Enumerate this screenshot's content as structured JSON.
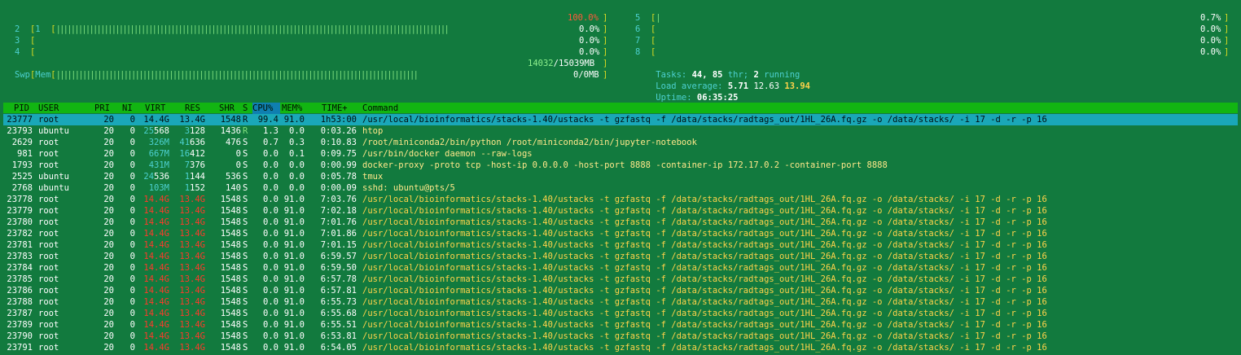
{
  "cpus_left": [
    {
      "id": "1",
      "bar": "||||||||||||||||||||||||||||||||||||||||||||||||||||||||||||||||||||||||||||||||||||||||||||||||||||||||||",
      "pct": "100.0%"
    },
    {
      "id": "2",
      "bar": "",
      "pct": "0.0%"
    },
    {
      "id": "3",
      "bar": "",
      "pct": "0.0%"
    },
    {
      "id": "4",
      "bar": "",
      "pct": "0.0%"
    }
  ],
  "cpus_right": [
    {
      "id": "5",
      "bar": "|",
      "pct": "0.7%"
    },
    {
      "id": "6",
      "bar": "",
      "pct": "0.0%"
    },
    {
      "id": "7",
      "bar": "",
      "pct": "0.0%"
    },
    {
      "id": "8",
      "bar": "",
      "pct": "0.0%"
    }
  ],
  "mem": {
    "label": "Mem",
    "bar": "||||||||||||||||||||||||||||||||||||||||||||||||||||||||||||||||||||||||||||||||||||||||||||||||",
    "used": "14032",
    "total": "15039MB"
  },
  "swp": {
    "label": "Swp",
    "value": "0/0MB"
  },
  "tasks": {
    "label": "Tasks:",
    "count": "44,",
    "thr": "85",
    "thr_label": "thr;",
    "running": "2",
    "running_label": "running"
  },
  "load": {
    "label": "Load average:",
    "v1": "5.71",
    "v5": "12.63",
    "v15": "13.94"
  },
  "uptime": {
    "label": "Uptime:",
    "value": "06:35:25"
  },
  "columns": [
    "PID",
    "USER",
    "PRI",
    "NI",
    "VIRT",
    "RES",
    "SHR",
    "S",
    "CPU%",
    "MEM%",
    "TIME+",
    "Command"
  ],
  "processes": [
    {
      "pid": "23777",
      "user": "root",
      "pri": "20",
      "ni": "0",
      "virt": "14.4G",
      "res": "13.4G",
      "shr": "1548",
      "s": "R",
      "cpu": "99.4",
      "mem": "91.0",
      "time": "1h53:00",
      "cmd": "/usr/local/bioinformatics/stacks-1.40/ustacks -t gzfastq -f /data/stacks/radtags_out/1HL_26A.fq.gz -o /data/stacks/ -i 17 -d -r -p 16"
    },
    {
      "pid": "23793",
      "user": "ubuntu",
      "pri": "20",
      "ni": "0",
      "virt": "25568",
      "res": "3128",
      "shr": "1436",
      "s": "R",
      "cpu": "1.3",
      "mem": "0.0",
      "time": "0:03.26",
      "cmd": "htop"
    },
    {
      "pid": "2629",
      "user": "root",
      "pri": "20",
      "ni": "0",
      "virt": "326M",
      "res": "41636",
      "shr": "476",
      "s": "S",
      "cpu": "0.7",
      "mem": "0.3",
      "time": "0:10.83",
      "cmd": "/root/miniconda2/bin/python /root/miniconda2/bin/jupyter-notebook"
    },
    {
      "pid": "981",
      "user": "root",
      "pri": "20",
      "ni": "0",
      "virt": "667M",
      "res": "16412",
      "shr": "0",
      "s": "S",
      "cpu": "0.0",
      "mem": "0.1",
      "time": "0:09.75",
      "cmd": "/usr/bin/docker daemon --raw-logs"
    },
    {
      "pid": "1793",
      "user": "root",
      "pri": "20",
      "ni": "0",
      "virt": "431M",
      "res": "7376",
      "shr": "0",
      "s": "S",
      "cpu": "0.0",
      "mem": "0.0",
      "time": "0:00.99",
      "cmd": "docker-proxy -proto tcp -host-ip 0.0.0.0 -host-port 8888 -container-ip 172.17.0.2 -container-port 8888"
    },
    {
      "pid": "2525",
      "user": "ubuntu",
      "pri": "20",
      "ni": "0",
      "virt": "24536",
      "res": "1144",
      "shr": "536",
      "s": "S",
      "cpu": "0.0",
      "mem": "0.0",
      "time": "0:05.78",
      "cmd": "tmux"
    },
    {
      "pid": "2768",
      "user": "ubuntu",
      "pri": "20",
      "ni": "0",
      "virt": "103M",
      "res": "1152",
      "shr": "140",
      "s": "S",
      "cpu": "0.0",
      "mem": "0.0",
      "time": "0:00.09",
      "cmd": "sshd: ubuntu@pts/5"
    },
    {
      "pid": "23778",
      "user": "root",
      "pri": "20",
      "ni": "0",
      "virt": "14.4G",
      "res": "13.4G",
      "shr": "1548",
      "s": "S",
      "cpu": "0.0",
      "mem": "91.0",
      "time": "7:03.76",
      "cmd": "/usr/local/bioinformatics/stacks-1.40/ustacks -t gzfastq -f /data/stacks/radtags_out/1HL_26A.fq.gz -o /data/stacks/ -i 17 -d -r -p 16"
    },
    {
      "pid": "23779",
      "user": "root",
      "pri": "20",
      "ni": "0",
      "virt": "14.4G",
      "res": "13.4G",
      "shr": "1548",
      "s": "S",
      "cpu": "0.0",
      "mem": "91.0",
      "time": "7:02.18",
      "cmd": "/usr/local/bioinformatics/stacks-1.40/ustacks -t gzfastq -f /data/stacks/radtags_out/1HL_26A.fq.gz -o /data/stacks/ -i 17 -d -r -p 16"
    },
    {
      "pid": "23780",
      "user": "root",
      "pri": "20",
      "ni": "0",
      "virt": "14.4G",
      "res": "13.4G",
      "shr": "1548",
      "s": "S",
      "cpu": "0.0",
      "mem": "91.0",
      "time": "7:01.76",
      "cmd": "/usr/local/bioinformatics/stacks-1.40/ustacks -t gzfastq -f /data/stacks/radtags_out/1HL_26A.fq.gz -o /data/stacks/ -i 17 -d -r -p 16"
    },
    {
      "pid": "23782",
      "user": "root",
      "pri": "20",
      "ni": "0",
      "virt": "14.4G",
      "res": "13.4G",
      "shr": "1548",
      "s": "S",
      "cpu": "0.0",
      "mem": "91.0",
      "time": "7:01.86",
      "cmd": "/usr/local/bioinformatics/stacks-1.40/ustacks -t gzfastq -f /data/stacks/radtags_out/1HL_26A.fq.gz -o /data/stacks/ -i 17 -d -r -p 16"
    },
    {
      "pid": "23781",
      "user": "root",
      "pri": "20",
      "ni": "0",
      "virt": "14.4G",
      "res": "13.4G",
      "shr": "1548",
      "s": "S",
      "cpu": "0.0",
      "mem": "91.0",
      "time": "7:01.15",
      "cmd": "/usr/local/bioinformatics/stacks-1.40/ustacks -t gzfastq -f /data/stacks/radtags_out/1HL_26A.fq.gz -o /data/stacks/ -i 17 -d -r -p 16"
    },
    {
      "pid": "23783",
      "user": "root",
      "pri": "20",
      "ni": "0",
      "virt": "14.4G",
      "res": "13.4G",
      "shr": "1548",
      "s": "S",
      "cpu": "0.0",
      "mem": "91.0",
      "time": "6:59.57",
      "cmd": "/usr/local/bioinformatics/stacks-1.40/ustacks -t gzfastq -f /data/stacks/radtags_out/1HL_26A.fq.gz -o /data/stacks/ -i 17 -d -r -p 16"
    },
    {
      "pid": "23784",
      "user": "root",
      "pri": "20",
      "ni": "0",
      "virt": "14.4G",
      "res": "13.4G",
      "shr": "1548",
      "s": "S",
      "cpu": "0.0",
      "mem": "91.0",
      "time": "6:59.50",
      "cmd": "/usr/local/bioinformatics/stacks-1.40/ustacks -t gzfastq -f /data/stacks/radtags_out/1HL_26A.fq.gz -o /data/stacks/ -i 17 -d -r -p 16"
    },
    {
      "pid": "23785",
      "user": "root",
      "pri": "20",
      "ni": "0",
      "virt": "14.4G",
      "res": "13.4G",
      "shr": "1548",
      "s": "S",
      "cpu": "0.0",
      "mem": "91.0",
      "time": "6:57.78",
      "cmd": "/usr/local/bioinformatics/stacks-1.40/ustacks -t gzfastq -f /data/stacks/radtags_out/1HL_26A.fq.gz -o /data/stacks/ -i 17 -d -r -p 16"
    },
    {
      "pid": "23786",
      "user": "root",
      "pri": "20",
      "ni": "0",
      "virt": "14.4G",
      "res": "13.4G",
      "shr": "1548",
      "s": "S",
      "cpu": "0.0",
      "mem": "91.0",
      "time": "6:57.81",
      "cmd": "/usr/local/bioinformatics/stacks-1.40/ustacks -t gzfastq -f /data/stacks/radtags_out/1HL_26A.fq.gz -o /data/stacks/ -i 17 -d -r -p 16"
    },
    {
      "pid": "23788",
      "user": "root",
      "pri": "20",
      "ni": "0",
      "virt": "14.4G",
      "res": "13.4G",
      "shr": "1548",
      "s": "S",
      "cpu": "0.0",
      "mem": "91.0",
      "time": "6:55.73",
      "cmd": "/usr/local/bioinformatics/stacks-1.40/ustacks -t gzfastq -f /data/stacks/radtags_out/1HL_26A.fq.gz -o /data/stacks/ -i 17 -d -r -p 16"
    },
    {
      "pid": "23787",
      "user": "root",
      "pri": "20",
      "ni": "0",
      "virt": "14.4G",
      "res": "13.4G",
      "shr": "1548",
      "s": "S",
      "cpu": "0.0",
      "mem": "91.0",
      "time": "6:55.68",
      "cmd": "/usr/local/bioinformatics/stacks-1.40/ustacks -t gzfastq -f /data/stacks/radtags_out/1HL_26A.fq.gz -o /data/stacks/ -i 17 -d -r -p 16"
    },
    {
      "pid": "23789",
      "user": "root",
      "pri": "20",
      "ni": "0",
      "virt": "14.4G",
      "res": "13.4G",
      "shr": "1548",
      "s": "S",
      "cpu": "0.0",
      "mem": "91.0",
      "time": "6:55.51",
      "cmd": "/usr/local/bioinformatics/stacks-1.40/ustacks -t gzfastq -f /data/stacks/radtags_out/1HL_26A.fq.gz -o /data/stacks/ -i 17 -d -r -p 16"
    },
    {
      "pid": "23790",
      "user": "root",
      "pri": "20",
      "ni": "0",
      "virt": "14.4G",
      "res": "13.4G",
      "shr": "1548",
      "s": "S",
      "cpu": "0.0",
      "mem": "91.0",
      "time": "6:53.81",
      "cmd": "/usr/local/bioinformatics/stacks-1.40/ustacks -t gzfastq -f /data/stacks/radtags_out/1HL_26A.fq.gz -o /data/stacks/ -i 17 -d -r -p 16"
    },
    {
      "pid": "23791",
      "user": "root",
      "pri": "20",
      "ni": "0",
      "virt": "14.4G",
      "res": "13.4G",
      "shr": "1548",
      "s": "S",
      "cpu": "0.0",
      "mem": "91.0",
      "time": "6:54.05",
      "cmd": "/usr/local/bioinformatics/stacks-1.40/ustacks -t gzfastq -f /data/stacks/radtags_out/1HL_26A.fq.gz -o /data/stacks/ -i 17 -d -r -p 16"
    }
  ]
}
